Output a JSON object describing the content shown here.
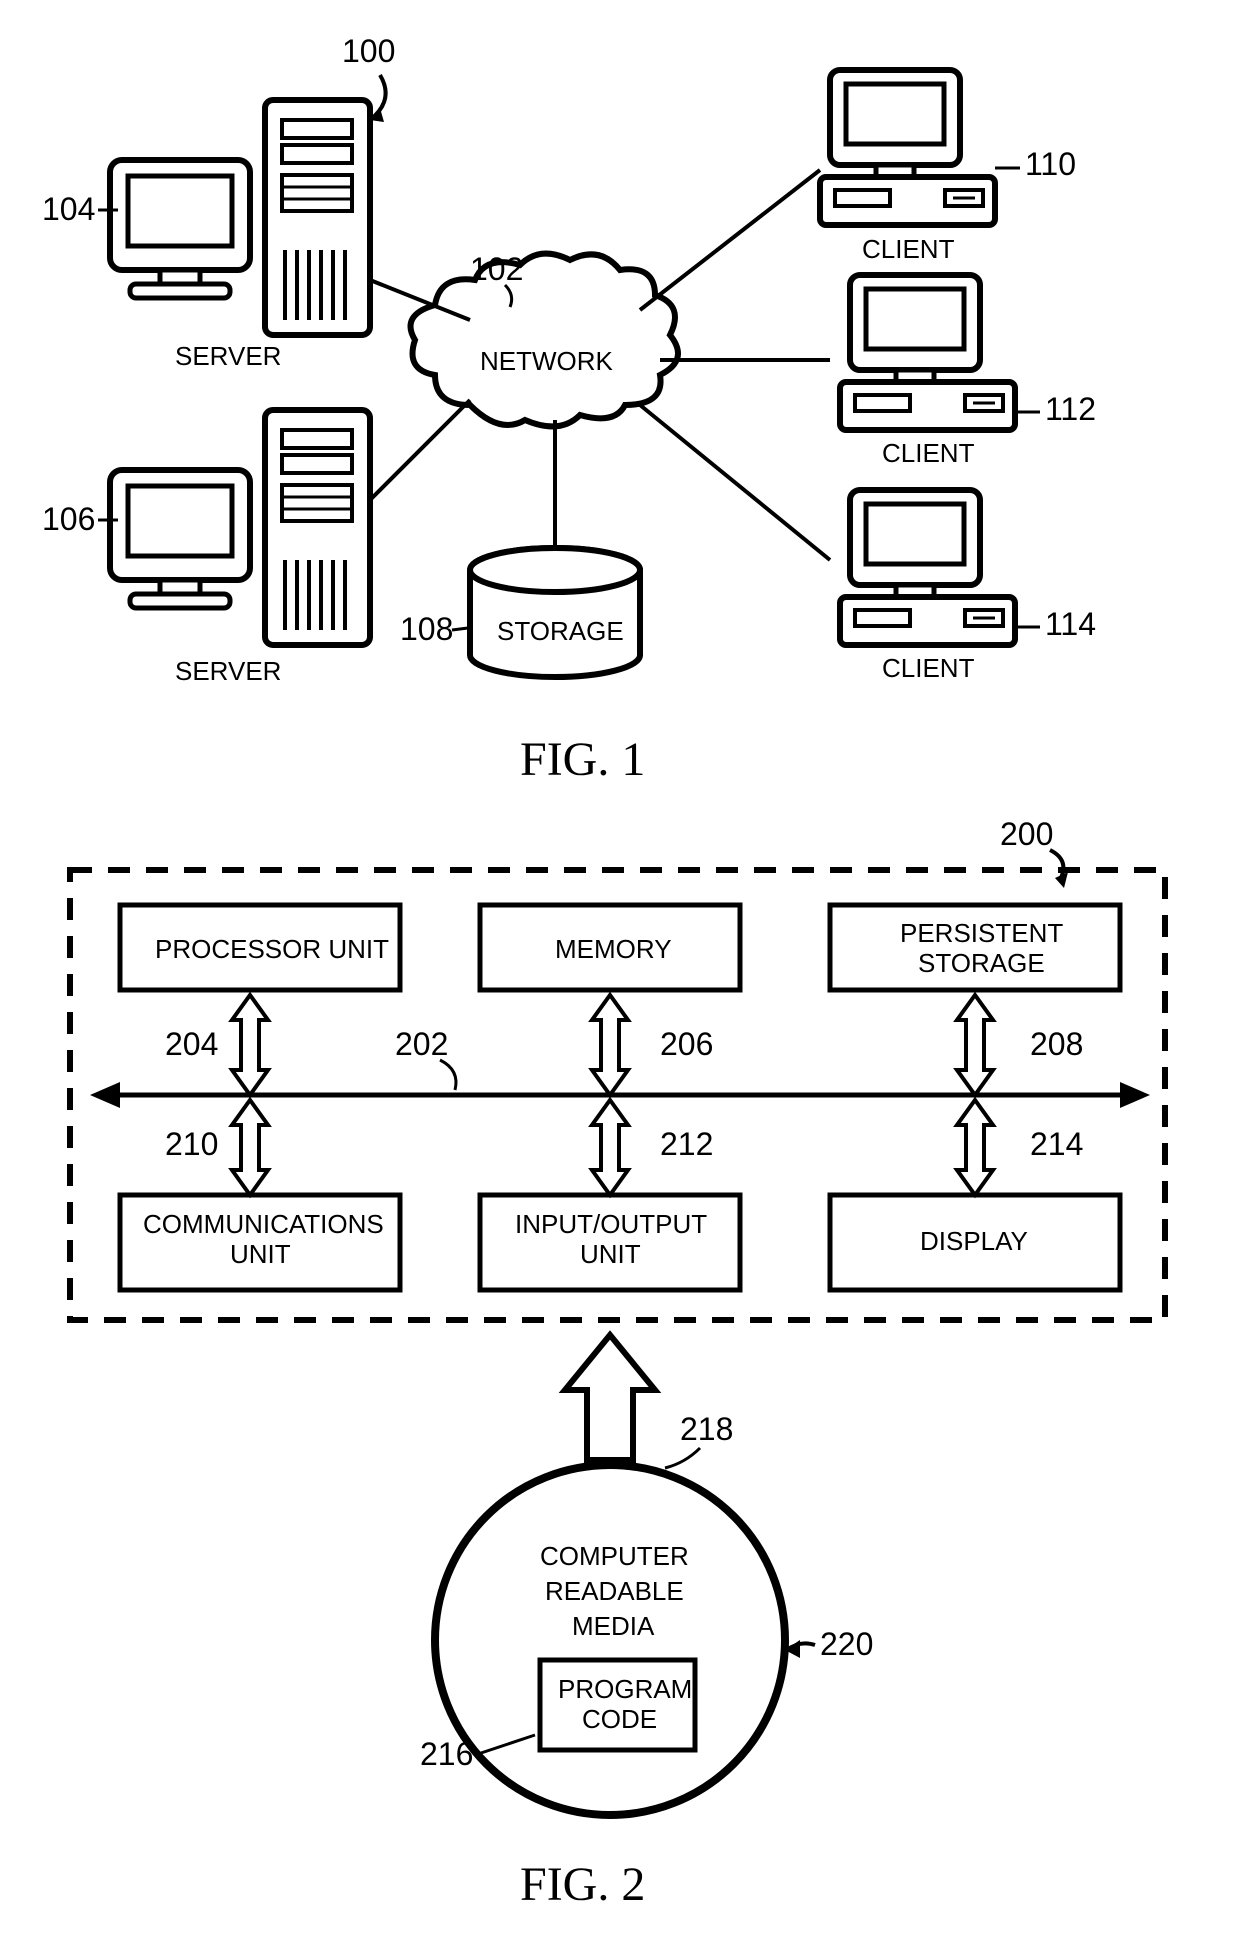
{
  "fig1": {
    "title": "FIG. 1",
    "refs": {
      "r100": "100",
      "r102": "102",
      "r104": "104",
      "r106": "106",
      "r108": "108",
      "r110": "110",
      "r112": "112",
      "r114": "114"
    },
    "labels": {
      "server1": "SERVER",
      "server2": "SERVER",
      "client1": "CLIENT",
      "client2": "CLIENT",
      "client3": "CLIENT",
      "network": "NETWORK",
      "storage": "STORAGE"
    }
  },
  "fig2": {
    "title": "FIG. 2",
    "refs": {
      "r200": "200",
      "r202": "202",
      "r204": "204",
      "r206": "206",
      "r208": "208",
      "r210": "210",
      "r212": "212",
      "r214": "214",
      "r216": "216",
      "r218": "218",
      "r220": "220"
    },
    "blocks": {
      "proc": "PROCESSOR UNIT",
      "mem": "MEMORY",
      "pers1": "PERSISTENT",
      "pers2": "STORAGE",
      "comm1": "COMMUNICATIONS",
      "comm2": "UNIT",
      "io1": "INPUT/OUTPUT",
      "io2": "UNIT",
      "disp": "DISPLAY",
      "media1": "COMPUTER",
      "media2": "READABLE",
      "media3": "MEDIA",
      "code1": "PROGRAM",
      "code2": "CODE"
    }
  }
}
